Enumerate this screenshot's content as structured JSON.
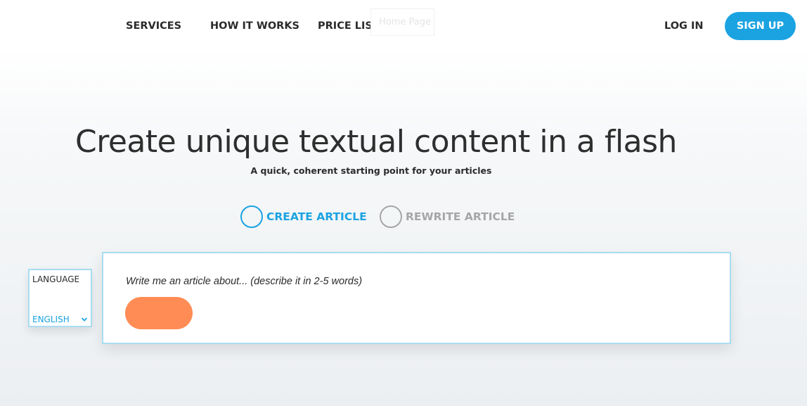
{
  "nav": {
    "services": "SERVICES",
    "how_it_works": "HOW IT WORKS",
    "price_list": "PRICE LIST",
    "home_tooltip": "Home Page",
    "login": "LOG IN",
    "signup": "SIGN UP"
  },
  "hero": {
    "title": "Create unique textual content in a flash",
    "subtitle": "A quick, coherent starting point for your articles"
  },
  "modes": {
    "create": "CREATE ARTICLE",
    "rewrite": "REWRITE ARTICLE"
  },
  "language": {
    "label": "LANGUAGE",
    "selected": "ENGLISH"
  },
  "article": {
    "placeholder": "Write me an article about... (describe it in 2-5 words)",
    "value": ""
  },
  "colors": {
    "accent": "#1ba3e1",
    "button": "#ff8c55",
    "border": "#a9ddf1",
    "inactive": "#a6a6a6"
  }
}
